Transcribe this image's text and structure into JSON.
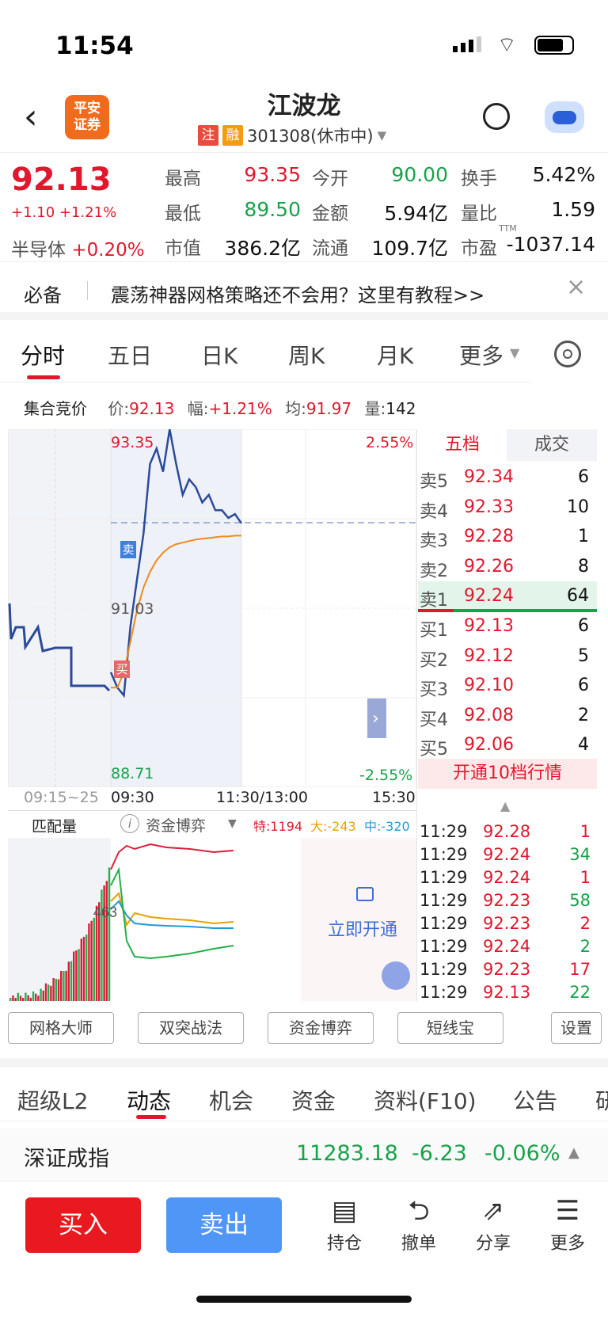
{
  "status": {
    "time": "11:54"
  },
  "header": {
    "title": "江波龙",
    "tag1": "注",
    "tag2": "融",
    "code": "301308(休市中)",
    "logo": "平安\n证券"
  },
  "quote": {
    "price": "92.13",
    "change": "+1.10",
    "pct": "+1.21%",
    "sector": "半导体",
    "sector_pct": "+0.20%",
    "cells": [
      {
        "label": "最高",
        "value": "93.35",
        "color": "red"
      },
      {
        "label": "今开",
        "value": "90.00",
        "color": "green"
      },
      {
        "label": "换手",
        "value": "5.42%",
        "color": "black"
      },
      {
        "label": "最低",
        "value": "89.50",
        "color": "green"
      },
      {
        "label": "金额",
        "value": "5.94亿",
        "color": "black"
      },
      {
        "label": "量比",
        "value": "1.59",
        "color": "black"
      },
      {
        "label": "市值",
        "value": "386.2亿",
        "color": "black"
      },
      {
        "label": "流通",
        "value": "109.7亿",
        "color": "black"
      },
      {
        "label": "市盈",
        "value": "-1037.14",
        "color": "black"
      }
    ],
    "ttm": "TTM"
  },
  "banner": {
    "prefix": "必备",
    "text": "震荡神器网格策略还不会用？这里有教程>>"
  },
  "chart_tabs": [
    "分时",
    "五日",
    "日K",
    "周K",
    "月K",
    "更多"
  ],
  "auction": {
    "label": "集合竞价",
    "price_label": "价:",
    "price": "92.13",
    "amp_label": "幅:",
    "amp": "+1.21%",
    "avg_label": "均:",
    "avg": "91.97",
    "vol_label": "量:",
    "vol": "142"
  },
  "intraday": {
    "y_high": "93.35",
    "y_mid": "91.03",
    "y_low": "88.71",
    "pct_high": "2.55%",
    "pct_low": "-2.55%",
    "t0": "09:15~25",
    "t1": "09:30",
    "t2": "11:30/13:00",
    "t3": "15:30",
    "sell_mark": "卖",
    "buy_mark": "买"
  },
  "chart_data": {
    "type": "line",
    "title": "分时",
    "ylim": [
      88.71,
      93.35
    ],
    "series": [
      {
        "name": "价",
        "values": [
          90.2,
          90.0,
          89.9,
          90.8,
          91.4,
          92.0,
          92.9,
          93.1,
          92.8,
          93.35,
          92.9,
          92.5,
          92.7,
          92.6,
          92.4,
          92.5,
          92.3,
          92.3,
          92.2,
          92.25,
          92.13
        ]
      },
      {
        "name": "均",
        "values": [
          90.0,
          90.0,
          90.2,
          90.6,
          91.0,
          91.3,
          91.5,
          91.65,
          91.75,
          91.82,
          91.86,
          91.88,
          91.9,
          91.92,
          91.93,
          91.94,
          91.95,
          91.96,
          91.96,
          91.97,
          91.97
        ]
      }
    ]
  },
  "orderbook": {
    "tab1": "五档",
    "tab2": "成交",
    "sells": [
      {
        "label": "卖5",
        "price": "92.34",
        "vol": "6"
      },
      {
        "label": "卖4",
        "price": "92.33",
        "vol": "10"
      },
      {
        "label": "卖3",
        "price": "92.28",
        "vol": "1"
      },
      {
        "label": "卖2",
        "price": "92.26",
        "vol": "8"
      },
      {
        "label": "卖1",
        "price": "92.24",
        "vol": "64"
      }
    ],
    "buys": [
      {
        "label": "买1",
        "price": "92.13",
        "vol": "6"
      },
      {
        "label": "买2",
        "price": "92.12",
        "vol": "5"
      },
      {
        "label": "买3",
        "price": "92.10",
        "vol": "6"
      },
      {
        "label": "买4",
        "price": "92.08",
        "vol": "2"
      },
      {
        "label": "买5",
        "price": "92.06",
        "vol": "4"
      }
    ],
    "upgrade": "开通10档行情"
  },
  "ticks": [
    {
      "t": "11:29",
      "p": "92.28",
      "v": "1"
    },
    {
      "t": "11:29",
      "p": "92.24",
      "v": "34"
    },
    {
      "t": "11:29",
      "p": "92.24",
      "v": "1"
    },
    {
      "t": "11:29",
      "p": "92.23",
      "v": "58"
    },
    {
      "t": "11:29",
      "p": "92.23",
      "v": "2"
    },
    {
      "t": "11:29",
      "p": "92.24",
      "v": "2"
    },
    {
      "t": "11:29",
      "p": "92.23",
      "v": "17"
    },
    {
      "t": "11:29",
      "p": "92.13",
      "v": "22"
    }
  ],
  "lower": {
    "match": "匹配量",
    "fund": "资金博弈",
    "te": "特:1194",
    "da": "大:-243",
    "zhong": "中:-320",
    "value": "463",
    "unlock": "立即开通"
  },
  "tools": [
    "网格大师",
    "双突战法",
    "资金博弈",
    "短线宝",
    "设置"
  ],
  "bottom_tabs": [
    "超级L2",
    "动态",
    "机会",
    "资金",
    "资料(F10)",
    "公告",
    "研"
  ],
  "index": {
    "name": "深证成指",
    "value": "11283.18",
    "change": "-6.23",
    "pct": "-0.06%"
  },
  "actions": {
    "buy": "买入",
    "sell": "卖出",
    "hold": "持仓",
    "cancel": "撤单",
    "share": "分享",
    "more": "更多"
  }
}
